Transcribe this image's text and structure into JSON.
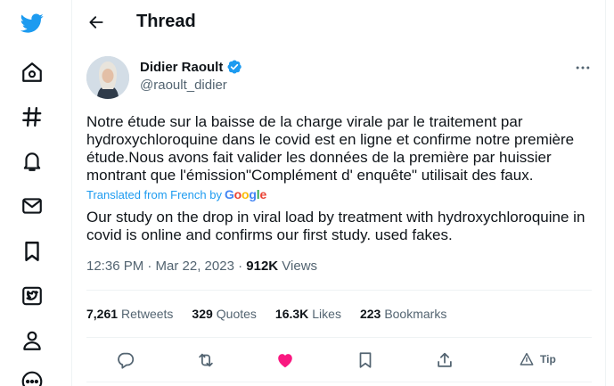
{
  "header": {
    "title": "Thread"
  },
  "author": {
    "name": "Didier Raoult",
    "handle": "@raoult_didier",
    "verified": true
  },
  "tweet": {
    "text": "Notre étude sur la baisse de la charge virale par le traitement par hydroxychloroquine dans le covid est en ligne et confirme notre première étude.Nous avons fait valider les données de la première par huissier montrant que l'émission\"Complément d' enquête\" utilisait des faux.",
    "translated_label": "Translated from French by",
    "translator": "Google",
    "translation": "Our study on the drop in viral load by treatment with hydroxychloroquine in covid is online and confirms our first study. used fakes.",
    "time": "12:36 PM · Mar 22, 2023 · ",
    "views_count": "912K",
    "views_label": " Views"
  },
  "stats": {
    "retweets": {
      "count": "7,261",
      "label": "Retweets"
    },
    "quotes": {
      "count": "329",
      "label": "Quotes"
    },
    "likes": {
      "count": "16.3K",
      "label": "Likes"
    },
    "bookmarks": {
      "count": "223",
      "label": "Bookmarks"
    }
  },
  "actions": {
    "tip_label": "Tip"
  },
  "colors": {
    "brand": "#1d9bf0",
    "like": "#f91880",
    "muted": "#536471",
    "text": "#0f1419",
    "border": "#eff3f4"
  },
  "nav_icons": [
    "twitter-logo-icon",
    "home-icon",
    "explore-icon",
    "notifications-icon",
    "messages-icon",
    "bookmarks-icon",
    "twitter-blue-icon",
    "profile-icon",
    "more-icon"
  ]
}
